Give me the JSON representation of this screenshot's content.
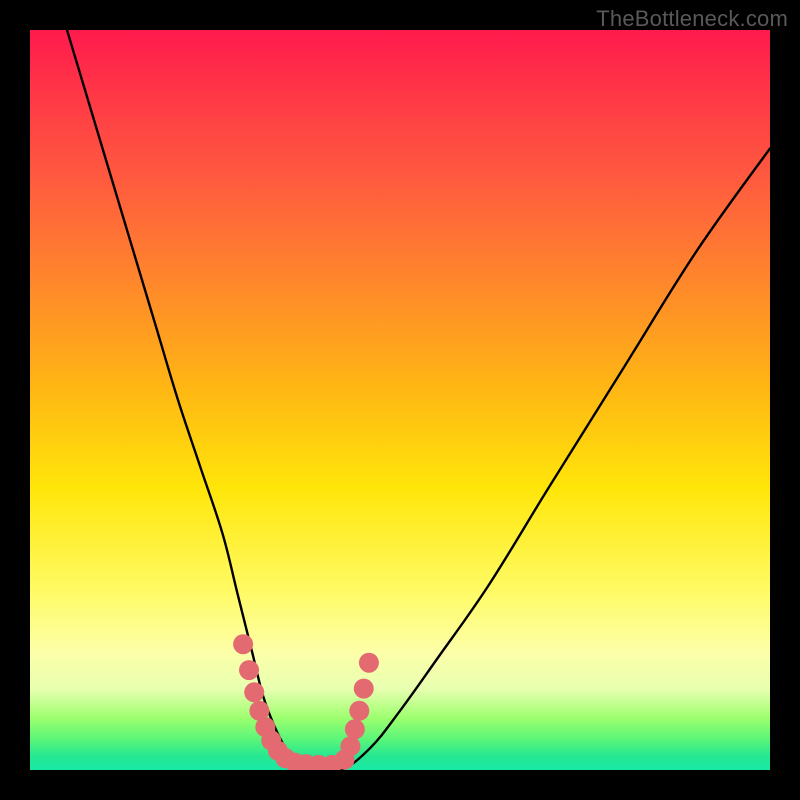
{
  "watermark": "TheBottleneck.com",
  "chart_data": {
    "type": "line",
    "title": "",
    "xlabel": "",
    "ylabel": "",
    "xlim": [
      0,
      100
    ],
    "ylim": [
      0,
      100
    ],
    "series": [
      {
        "name": "bottleneck-curve",
        "x": [
          5,
          8,
          11,
          14,
          17,
          20,
          23,
          26,
          28,
          30,
          31.5,
          33,
          34.5,
          36,
          38,
          42,
          46,
          50,
          55,
          62,
          70,
          80,
          90,
          100
        ],
        "percent": [
          100,
          90,
          80,
          70,
          60,
          50,
          41,
          32,
          24,
          16,
          10,
          6,
          3,
          1,
          0,
          0,
          3,
          8,
          15,
          25,
          38,
          54,
          70,
          84
        ]
      }
    ],
    "markers": {
      "name": "highlight-dots",
      "color": "#e46a72",
      "points": [
        {
          "x": 28.8,
          "percent": 17
        },
        {
          "x": 29.6,
          "percent": 13.5
        },
        {
          "x": 30.3,
          "percent": 10.5
        },
        {
          "x": 31.0,
          "percent": 8
        },
        {
          "x": 31.8,
          "percent": 5.8
        },
        {
          "x": 32.6,
          "percent": 4
        },
        {
          "x": 33.5,
          "percent": 2.6
        },
        {
          "x": 34.5,
          "percent": 1.6
        },
        {
          "x": 35.8,
          "percent": 1
        },
        {
          "x": 37.3,
          "percent": 0.8
        },
        {
          "x": 39.0,
          "percent": 0.7
        },
        {
          "x": 40.8,
          "percent": 0.7
        },
        {
          "x": 42.5,
          "percent": 1.4
        },
        {
          "x": 43.3,
          "percent": 3.2
        },
        {
          "x": 43.9,
          "percent": 5.5
        },
        {
          "x": 44.5,
          "percent": 8
        },
        {
          "x": 45.1,
          "percent": 11
        },
        {
          "x": 45.8,
          "percent": 14.5
        }
      ]
    },
    "gradient_stops": [
      {
        "pos": 0,
        "color": "#ff1a4d"
      },
      {
        "pos": 35,
        "color": "#ff8a2a"
      },
      {
        "pos": 62,
        "color": "#ffe60a"
      },
      {
        "pos": 84,
        "color": "#fdffa8"
      },
      {
        "pos": 100,
        "color": "#18e8a6"
      }
    ]
  }
}
